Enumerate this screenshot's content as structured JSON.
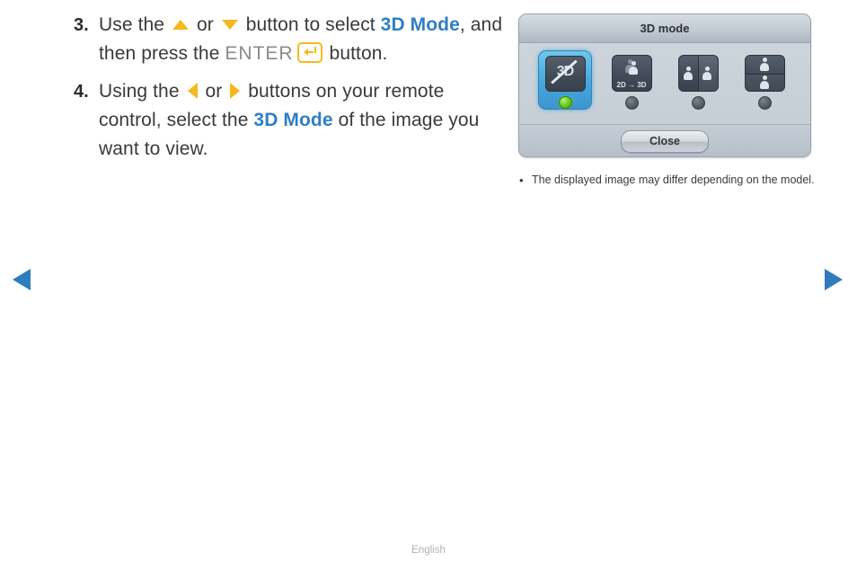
{
  "steps": [
    {
      "number": "3.",
      "segments": [
        {
          "type": "text",
          "value": "Use the "
        },
        {
          "type": "icon",
          "value": "triangle-up-icon"
        },
        {
          "type": "text",
          "value": " or "
        },
        {
          "type": "icon",
          "value": "triangle-down-icon"
        },
        {
          "type": "text",
          "value": " button to select "
        },
        {
          "type": "keyword-blue",
          "value": "3D Mode"
        },
        {
          "type": "text",
          "value": ", and then press the "
        },
        {
          "type": "keyword-gray",
          "value": "ENTER"
        },
        {
          "type": "icon",
          "value": "enter-key-icon"
        },
        {
          "type": "text",
          "value": " button."
        }
      ],
      "line1_a": "Use the ",
      "line1_b": " or ",
      "line1_c": " button to select ",
      "keyword1": "3D Mode",
      "line1_d": ",",
      "line2_a": "and then press the ",
      "enter_label": "ENTER",
      "line2_b": " button."
    },
    {
      "number": "4.",
      "line1_a": "Using the ",
      "line1_b": " or ",
      "line1_c": " buttons on your remote",
      "line2_a": "control, select the ",
      "keyword1": "3D Mode",
      "line2_b": " of the image",
      "line3_a": "you want to view."
    }
  ],
  "dialog": {
    "title": "3D mode",
    "modes": [
      {
        "name": "3d-off",
        "selected": true,
        "icon_label": "3D",
        "led": "on"
      },
      {
        "name": "2d-to-3d",
        "selected": false,
        "icon_label": "2D → 3D",
        "led": "off"
      },
      {
        "name": "side-by-side",
        "selected": false,
        "icon_label": "",
        "led": "off"
      },
      {
        "name": "top-bottom",
        "selected": false,
        "icon_label": "",
        "led": "off"
      }
    ],
    "close_label": "Close"
  },
  "note": {
    "bullet": "•",
    "text": "The displayed image may differ depending on the model."
  },
  "nav": {
    "prev_label": "previous-page",
    "next_label": "next-page"
  },
  "footer": {
    "language": "English"
  },
  "colors": {
    "keyword_blue": "#2f7fc4",
    "keyword_gray": "#8a8a8a",
    "arrow_yellow": "#f5b81d",
    "nav_blue": "#2e7cbd",
    "led_green": "#6fd225",
    "selection_blue": "#45a7dd"
  }
}
